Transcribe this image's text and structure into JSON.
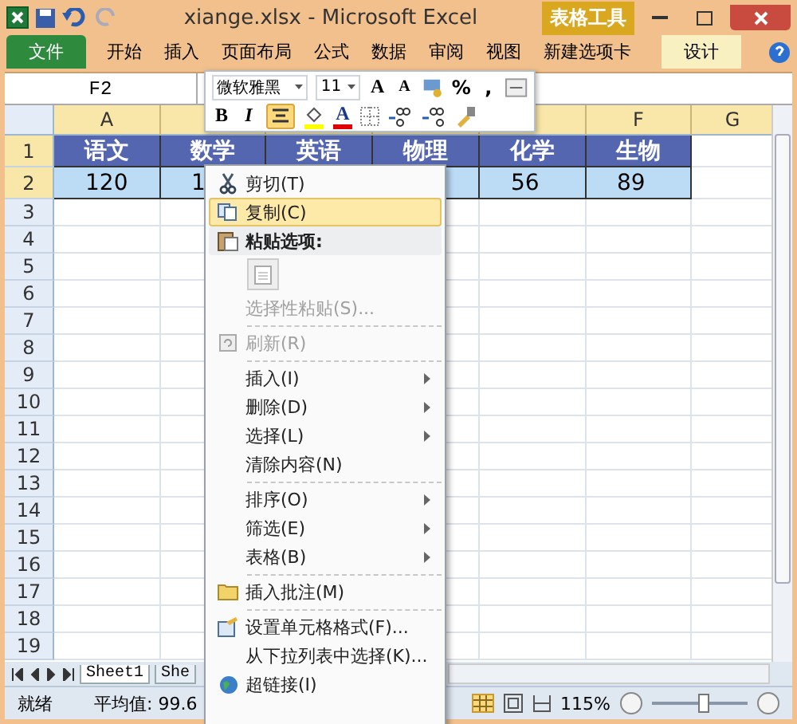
{
  "window": {
    "title": "xiange.xlsx - Microsoft Excel",
    "context_tab": "表格工具"
  },
  "ribbon_tabs": [
    {
      "label": "文件",
      "kind": "file",
      "selected": false
    },
    {
      "label": "开始",
      "kind": "tab",
      "selected": false
    },
    {
      "label": "插入",
      "kind": "tab",
      "selected": false
    },
    {
      "label": "页面布局",
      "kind": "tab",
      "selected": false
    },
    {
      "label": "公式",
      "kind": "tab",
      "selected": false
    },
    {
      "label": "数据",
      "kind": "tab",
      "selected": false
    },
    {
      "label": "审阅",
      "kind": "tab",
      "selected": false
    },
    {
      "label": "视图",
      "kind": "tab",
      "selected": false
    },
    {
      "label": "新建选项卡",
      "kind": "tab",
      "selected": false
    },
    {
      "label": "设计",
      "kind": "context",
      "selected": false
    }
  ],
  "name_box": "F2",
  "column_headers": [
    "A",
    "F",
    "G"
  ],
  "rows": [
    {
      "number": "1",
      "kind": "header",
      "cells": [
        {
          "text": "语文"
        },
        {
          "text": "数学"
        },
        {
          "text": "英语"
        },
        {
          "text": "物理"
        },
        {
          "text": "化学"
        },
        {
          "text": "生物"
        },
        {}
      ]
    },
    {
      "number": "2",
      "kind": "data",
      "cells": [
        {
          "text": "120"
        },
        {
          "text": "1"
        },
        {},
        {},
        {
          "text": "56"
        },
        {
          "text": "89"
        },
        {}
      ]
    },
    {
      "number": "3",
      "kind": "empty",
      "cells": []
    },
    {
      "number": "4",
      "kind": "empty",
      "cells": []
    },
    {
      "number": "5",
      "kind": "empty",
      "cells": []
    },
    {
      "number": "6",
      "kind": "empty",
      "cells": []
    },
    {
      "number": "7",
      "kind": "empty",
      "cells": []
    },
    {
      "number": "8",
      "kind": "empty",
      "cells": []
    },
    {
      "number": "9",
      "kind": "empty",
      "cells": []
    },
    {
      "number": "10",
      "kind": "empty",
      "cells": []
    },
    {
      "number": "11",
      "kind": "empty",
      "cells": []
    },
    {
      "number": "12",
      "kind": "empty",
      "cells": []
    },
    {
      "number": "13",
      "kind": "empty",
      "cells": []
    },
    {
      "number": "14",
      "kind": "empty",
      "cells": []
    },
    {
      "number": "15",
      "kind": "empty",
      "cells": []
    },
    {
      "number": "16",
      "kind": "empty",
      "cells": []
    },
    {
      "number": "17",
      "kind": "empty",
      "cells": []
    },
    {
      "number": "18",
      "kind": "empty",
      "cells": []
    },
    {
      "number": "19",
      "kind": "empty",
      "cells": []
    }
  ],
  "mini_toolbar": {
    "font": "微软雅黑",
    "size": "11",
    "grow": "A",
    "shrink": "A",
    "percent": "%",
    "comma": ",",
    "bold": "B",
    "italic": "I",
    "font_color": "A",
    "center_selected": true
  },
  "context_menu": [
    {
      "kind": "item",
      "label": "剪切(T)",
      "selected": false,
      "disabled": false
    },
    {
      "kind": "item",
      "label": "复制(C)",
      "selected": true,
      "disabled": false
    },
    {
      "kind": "header",
      "label": "粘贴选项:"
    },
    {
      "kind": "paste-options"
    },
    {
      "kind": "item",
      "label": "选择性粘贴(S)...",
      "selected": false,
      "disabled": true
    },
    {
      "kind": "separator"
    },
    {
      "kind": "item",
      "label": "刷新(R)",
      "selected": false,
      "disabled": true
    },
    {
      "kind": "separator"
    },
    {
      "kind": "submenu",
      "label": "插入(I)",
      "selected": false,
      "disabled": false
    },
    {
      "kind": "submenu",
      "label": "删除(D)",
      "selected": false,
      "disabled": false
    },
    {
      "kind": "submenu",
      "label": "选择(L)",
      "selected": false,
      "disabled": false
    },
    {
      "kind": "item",
      "label": "清除内容(N)",
      "selected": false,
      "disabled": false
    },
    {
      "kind": "separator"
    },
    {
      "kind": "submenu",
      "label": "排序(O)",
      "selected": false,
      "disabled": false
    },
    {
      "kind": "submenu",
      "label": "筛选(E)",
      "selected": false,
      "disabled": false
    },
    {
      "kind": "submenu",
      "label": "表格(B)",
      "selected": false,
      "disabled": false
    },
    {
      "kind": "separator"
    },
    {
      "kind": "item",
      "label": "插入批注(M)",
      "selected": false,
      "disabled": false
    },
    {
      "kind": "separator"
    },
    {
      "kind": "item",
      "label": "设置单元格格式(F)...",
      "selected": false,
      "disabled": false
    },
    {
      "kind": "item",
      "label": "从下拉列表中选择(K)...",
      "selected": false,
      "disabled": false
    },
    {
      "kind": "item",
      "label": "超链接(I)",
      "selected": false,
      "disabled": false
    }
  ],
  "sheet_tabs": [
    {
      "label": "Sheet1",
      "selected": true
    },
    {
      "label": "She",
      "selected": false
    }
  ],
  "status_bar": {
    "mode": "就绪",
    "average": "平均值: 99.6",
    "zoom": "115%",
    "zoom_slider": {
      "level": 0.55
    }
  }
}
